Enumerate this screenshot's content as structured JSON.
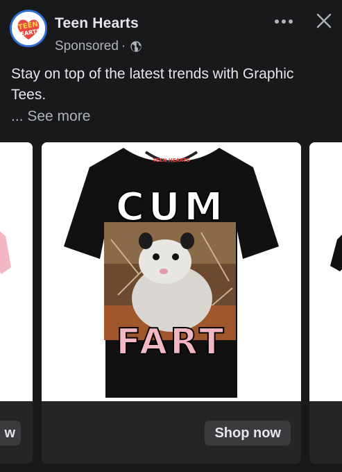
{
  "header": {
    "page_name": "Teen Hearts",
    "sponsored_label": "Sponsored",
    "separator": "·",
    "avatar_logo_text": "TEEN HEARTS"
  },
  "post": {
    "text": "Stay on top of the latest trends with Graphic Tees.",
    "see_more": "... See more"
  },
  "carousel": {
    "left_card_button_fragment": "w",
    "main_card": {
      "shirt_brand_text": "TEEN HEARTS",
      "shirt_text_top": "CUM",
      "shirt_text_bottom": "FART",
      "shop_button_label": "Shop now"
    }
  },
  "colors": {
    "background": "#18191a",
    "card_footer": "#242526",
    "button": "#3a3b3c",
    "text_primary": "#e4e6eb",
    "text_secondary": "#b0b3b8",
    "avatar_ring": "#2f6fd6"
  },
  "icons": {
    "more": "more-horizontal-icon",
    "close": "close-icon",
    "audience": "globe-icon"
  }
}
